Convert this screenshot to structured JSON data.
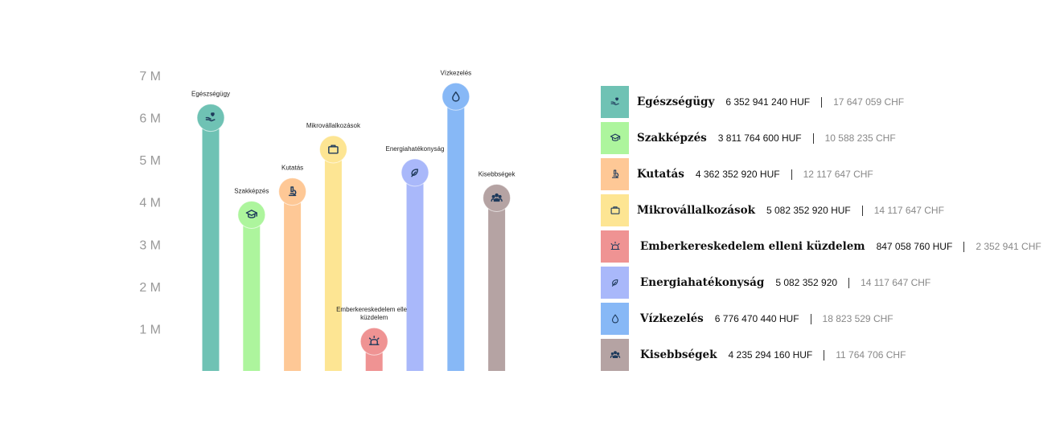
{
  "chart_data": {
    "type": "bar",
    "ylim": [
      0,
      7000000
    ],
    "yticks": [
      {
        "value": 1000000,
        "label": "1 M"
      },
      {
        "value": 2000000,
        "label": "2 M"
      },
      {
        "value": 3000000,
        "label": "3 M"
      },
      {
        "value": 4000000,
        "label": "4 M"
      },
      {
        "value": 5000000,
        "label": "5 M"
      },
      {
        "value": 6000000,
        "label": "6 M"
      },
      {
        "value": 7000000,
        "label": "7 M"
      }
    ],
    "categories": [
      {
        "name": "Egészségügy",
        "value": 6000000,
        "color": "#6fc2b4",
        "icon": "hand-heart-icon"
      },
      {
        "name": "Szakképzés",
        "value": 3700000,
        "color": "#adf59d",
        "icon": "graduation-cap-icon"
      },
      {
        "name": "Kutatás",
        "value": 4250000,
        "color": "#fec896",
        "icon": "microscope-icon"
      },
      {
        "name": "Mikrovállalkozások",
        "value": 5250000,
        "color": "#fde593",
        "icon": "briefcase-icon"
      },
      {
        "name": "Emberkereskedelem elleni küzdelem",
        "value": 700000,
        "color": "#ef9393",
        "icon": "siren-icon"
      },
      {
        "name": "Energiahatékonyság",
        "value": 4700000,
        "color": "#a9b8fa",
        "icon": "leaf-icon"
      },
      {
        "name": "Vízkezelés",
        "value": 6500000,
        "color": "#87b8f6",
        "icon": "water-drop-icon"
      },
      {
        "name": "Kisebbségek",
        "value": 4100000,
        "color": "#b5a3a3",
        "icon": "people-icon"
      }
    ]
  },
  "legend": [
    {
      "name": "Egészségügy",
      "huf": "6 352 941 240 HUF",
      "chf": "17 647 059 CHF",
      "color": "#6fc2b4",
      "icon": "hand-heart-icon"
    },
    {
      "name": "Szakképzés",
      "huf": "3 811 764 600 HUF",
      "chf": "10 588 235 CHF",
      "color": "#adf59d",
      "icon": "graduation-cap-icon"
    },
    {
      "name": "Kutatás",
      "huf": "4 362 352 920 HUF",
      "chf": "12 117 647 CHF",
      "color": "#fec896",
      "icon": "microscope-icon"
    },
    {
      "name": "Mikrovállalkozások",
      "huf": "5 082 352 920 HUF",
      "chf": "14 117 647 CHF",
      "color": "#fde593",
      "icon": "briefcase-icon"
    },
    {
      "name": "Emberkereskedelem elleni küzdelem",
      "huf": "847 058 760 HUF",
      "chf": "2 352 941 CHF",
      "color": "#ef9393",
      "icon": "siren-icon"
    },
    {
      "name": "Energiahatékonyság",
      "huf": "5 082 352 920",
      "chf": "14 117 647 CHF",
      "color": "#a9b8fa",
      "icon": "leaf-icon"
    },
    {
      "name": "Vízkezelés",
      "huf": "6 776 470 440 HUF",
      "chf": "18 823 529 CHF",
      "color": "#87b8f6",
      "icon": "water-drop-icon"
    },
    {
      "name": "Kisebbségek",
      "huf": "4 235 294 160 HUF",
      "chf": "11 764 706 CHF",
      "color": "#b5a3a3",
      "icon": "people-icon"
    }
  ]
}
